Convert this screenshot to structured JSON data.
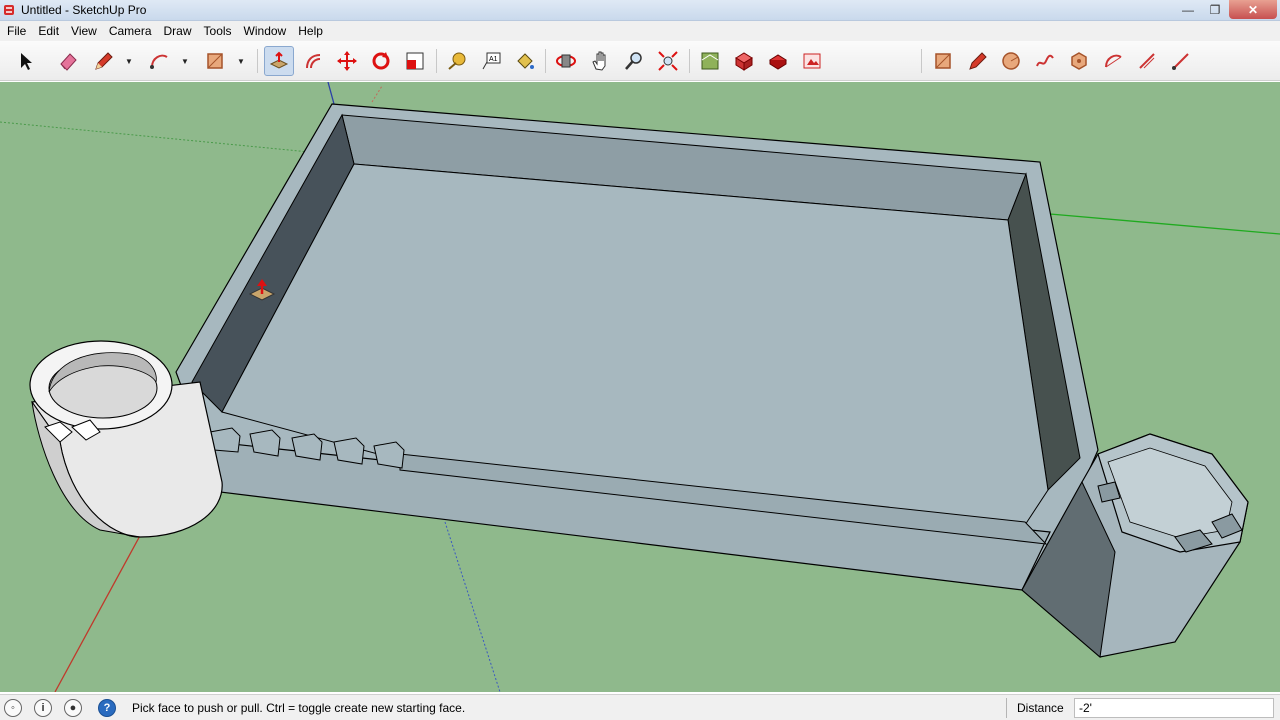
{
  "window": {
    "title": "Untitled - SketchUp Pro",
    "controls": {
      "minimize": "—",
      "maximize": "❐",
      "close": "✕"
    }
  },
  "menu": [
    "File",
    "Edit",
    "View",
    "Camera",
    "Draw",
    "Tools",
    "Window",
    "Help"
  ],
  "toolbar": {
    "tools": [
      {
        "name": "select-tool-button",
        "icon": "select-arrow-icon"
      },
      {
        "name": "eraser-tool-button",
        "icon": "eraser-icon"
      },
      {
        "name": "line-tool-button",
        "icon": "pencil-icon"
      },
      {
        "name": "arc-tool-button",
        "icon": "arc-icon"
      },
      {
        "name": "rectangle-tool-button",
        "icon": "rectangle-icon"
      },
      {
        "name": "push-pull-tool-button",
        "icon": "push-pull-icon",
        "active": true
      },
      {
        "name": "offset-tool-button",
        "icon": "offset-icon"
      },
      {
        "name": "move-tool-button",
        "icon": "move-icon"
      },
      {
        "name": "rotate-tool-button",
        "icon": "rotate-icon"
      },
      {
        "name": "scale-tool-button",
        "icon": "scale-icon"
      },
      {
        "name": "tape-measure-tool-button",
        "icon": "tape-measure-icon"
      },
      {
        "name": "text-tool-button",
        "icon": "text-icon"
      },
      {
        "name": "paint-bucket-tool-button",
        "icon": "paint-bucket-icon"
      },
      {
        "name": "orbit-tool-button",
        "icon": "orbit-icon"
      },
      {
        "name": "pan-tool-button",
        "icon": "pan-hand-icon"
      },
      {
        "name": "zoom-tool-button",
        "icon": "zoom-icon"
      },
      {
        "name": "zoom-extents-tool-button",
        "icon": "zoom-extents-icon"
      },
      {
        "name": "warehouse-button",
        "icon": "warehouse-icon"
      },
      {
        "name": "components-button",
        "icon": "components-icon"
      },
      {
        "name": "extension-warehouse-button",
        "icon": "extension-warehouse-icon"
      },
      {
        "name": "layout-button",
        "icon": "layout-icon"
      },
      {
        "name": "sketchy-rectangle-button",
        "icon": "rectangle-icon"
      },
      {
        "name": "sketchy-line-button",
        "icon": "pencil-icon"
      },
      {
        "name": "sketchy-circle-button",
        "icon": "circle-icon"
      },
      {
        "name": "sketchy-freehand-button",
        "icon": "freehand-icon"
      },
      {
        "name": "sketchy-polygon-button",
        "icon": "polygon-icon"
      },
      {
        "name": "sketchy-arc-button",
        "icon": "arc-icon"
      },
      {
        "name": "sketchy-edit-button",
        "icon": "edit-icon"
      },
      {
        "name": "sketchy-segment-button",
        "icon": "segment-icon"
      }
    ]
  },
  "colors": {
    "viewport_bg": "#8fb98c",
    "model_face": "#a7b8bf",
    "model_wall": "#909fa6",
    "model_dark": "#47514f",
    "tower_light": "#f3f3f3"
  },
  "status": {
    "hint": "Pick face to push or pull.  Ctrl = toggle create new starting face.",
    "measure_label": "Distance",
    "measure_value": "-2'"
  }
}
